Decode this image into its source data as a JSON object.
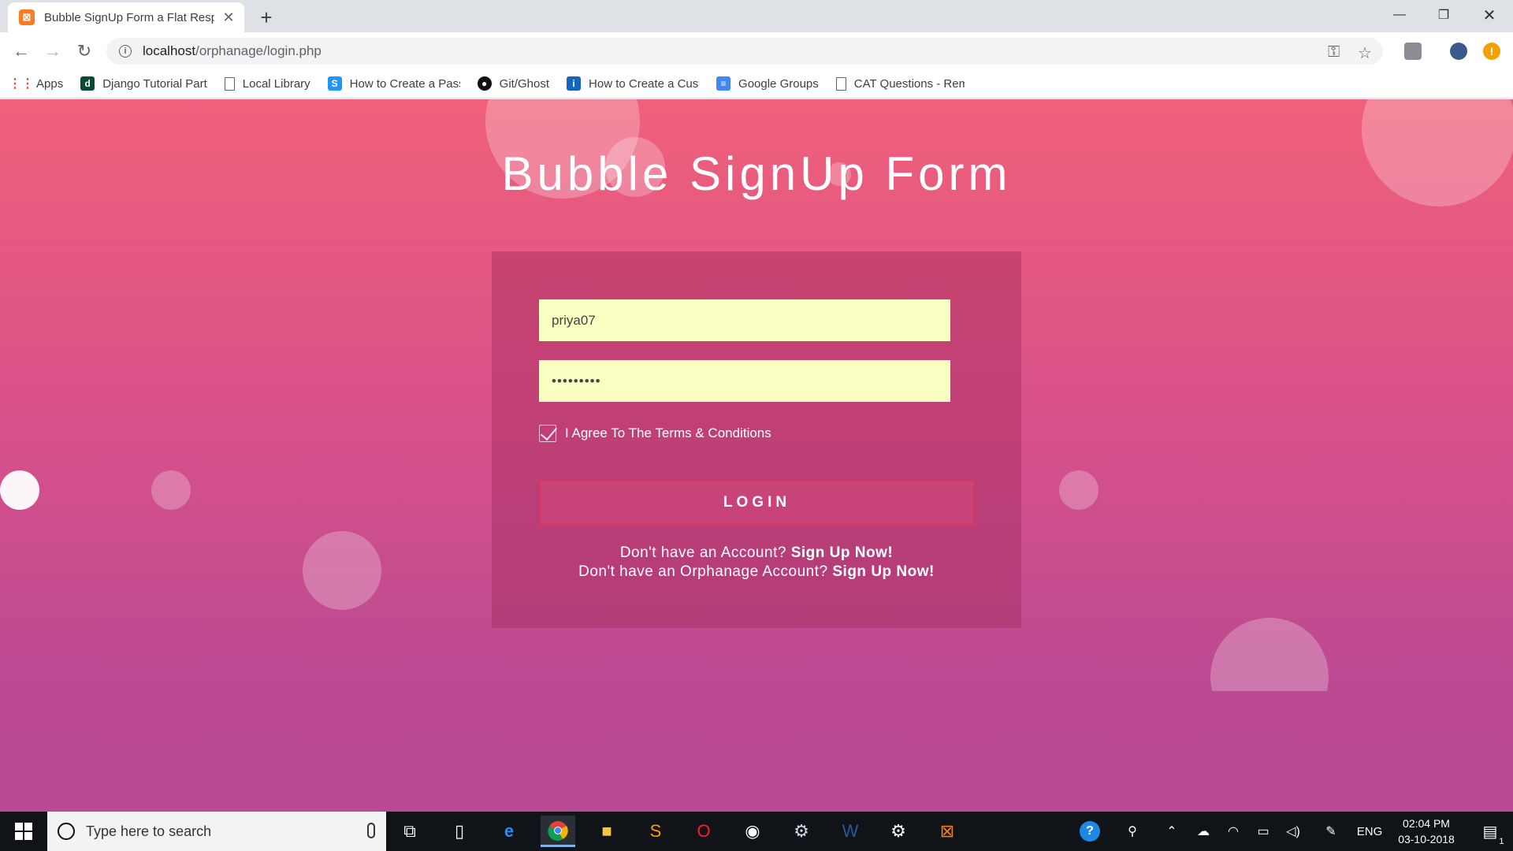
{
  "browser": {
    "tab_title": "Bubble SignUp Form a Flat Responsive",
    "tab_favicon": "xampp-icon",
    "url_host": "localhost",
    "url_path": "/orphanage/login.php",
    "bookmarks": [
      {
        "label": "Apps",
        "icon": "apps-grid-icon"
      },
      {
        "label": "Django Tutorial Part",
        "icon": "django-icon"
      },
      {
        "label": "Local Library",
        "icon": "page-icon"
      },
      {
        "label": "How to Create a Pass",
        "icon": "s-icon"
      },
      {
        "label": "Git/Ghost",
        "icon": "github-icon"
      },
      {
        "label": "How to Create a Cust",
        "icon": "info-icon"
      },
      {
        "label": "Google Groups",
        "icon": "google-groups-icon"
      },
      {
        "label": "CAT Questions - Rem",
        "icon": "page-icon"
      }
    ]
  },
  "page": {
    "title": "Bubble SignUp Form",
    "username_value": "priya07",
    "password_value": "•••••••••",
    "agree_label": "I Agree To The Terms & Conditions",
    "agree_checked": true,
    "login_label": "LOGIN",
    "signup1_text": "Don't have an Account?",
    "signup1_link": "Sign Up Now!",
    "signup2_text": "Don't have an Orphanage Account?",
    "signup2_link": "Sign Up Now!"
  },
  "taskbar": {
    "search_placeholder": "Type here to search",
    "language": "ENG",
    "time": "02:04 PM",
    "date": "03-10-2018",
    "notification_count": "1"
  },
  "colors": {
    "gradient_top": "#f0607a",
    "gradient_bottom": "#b84995",
    "field_bg": "#fafec0",
    "login_border": "#d9375a"
  }
}
